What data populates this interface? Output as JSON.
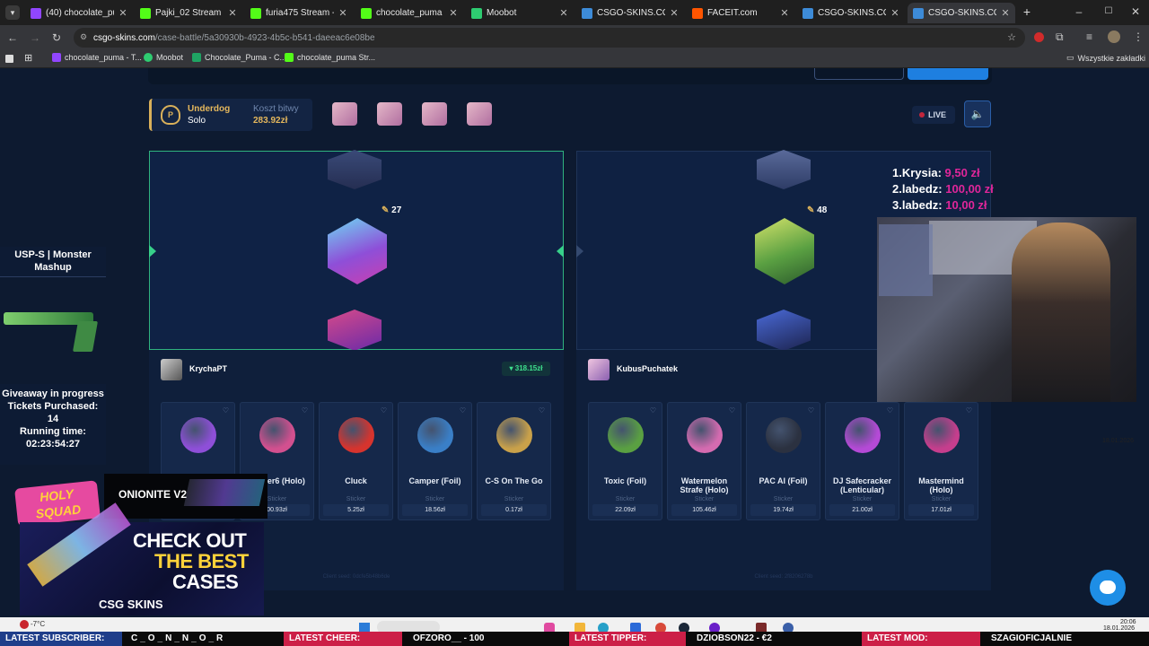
{
  "browser": {
    "tabs": [
      {
        "title": "(40) chocolate_puma",
        "color": "#9146ff"
      },
      {
        "title": "Pajki_02 Stream - Wa",
        "color": "#53fc18"
      },
      {
        "title": "furia475 Stream - Wa",
        "color": "#53fc18"
      },
      {
        "title": "chocolate_puma Strea",
        "color": "#53fc18"
      },
      {
        "title": "Moobot",
        "color": "#2ecc71"
      },
      {
        "title": "CSGO-SKINS.COM -",
        "color": "#3d8bd8"
      },
      {
        "title": "FACEIT.com",
        "color": "#ff5500"
      },
      {
        "title": "CSGO-SKINS.COM -",
        "color": "#3d8bd8"
      },
      {
        "title": "CSGO-SKINS.CO",
        "color": "#3d8bd8"
      }
    ],
    "url_host": "csgo-skins.com",
    "url_path": "/case-battle/5a30930b-4923-4b5c-b541-daeeac6e08be",
    "bookmarks": [
      "chocolate_puma - T...",
      "Moobot",
      "Chocolate_Puma - C...",
      "chocolate_puma Str..."
    ],
    "all_bookmarks": "Wszystkie zakładki"
  },
  "battle": {
    "mode_title": "Underdog",
    "mode_sub": "Solo",
    "cost_label": "Koszt bitwy",
    "cost_value": "283.92zł",
    "live_label": "LIVE",
    "left_count": "27",
    "right_count": "48",
    "left_player": "KrychaPT",
    "left_total": "318.15zł",
    "right_player": "KubusPuchatek",
    "seed_left": "Client seed: 0dcfe5b48b6de",
    "seed_right": "Client seed: 2f8206278b",
    "left_items": [
      {
        "name": "",
        "rarity": "",
        "price": "",
        "color": "#8e4fd8"
      },
      {
        "name": "ge Tier6 (Holo)",
        "rarity": "Sticker",
        "price": "00.93zł",
        "color": "#d2508f"
      },
      {
        "name": "Cluck",
        "rarity": "Sticker",
        "price": "5.25zł",
        "color": "#d6342e"
      },
      {
        "name": "Camper (Foil)",
        "rarity": "Sticker",
        "price": "18.56zł",
        "color": "#3a7fc7"
      },
      {
        "name": "C-S On The Go",
        "rarity": "Sticker",
        "price": "0.17zł",
        "color": "#c9a14a"
      }
    ],
    "right_items": [
      {
        "name": "Toxic (Foil)",
        "rarity": "Sticker",
        "price": "22.09zł",
        "color": "#5aa042"
      },
      {
        "name": "Watermelon Strafe (Holo)",
        "rarity": "Sticker",
        "price": "105.46zł",
        "color": "#d46bb0"
      },
      {
        "name": "PAC AI (Foil)",
        "rarity": "Sticker",
        "price": "19.74zł",
        "color": "#2b3140"
      },
      {
        "name": "DJ Safecracker (Lenticular)",
        "rarity": "Sticker",
        "price": "21.00zł",
        "color": "#b44ad6"
      },
      {
        "name": "Mastermind (Holo)",
        "rarity": "Sticker",
        "price": "17.01zł",
        "color": "#c53e8d"
      }
    ]
  },
  "overlay": {
    "leaderboard": [
      {
        "rank": "1.",
        "name": "Krysia:",
        "amount": "9,50 zł"
      },
      {
        "rank": "2.",
        "name": "labedz:",
        "amount": "100,00 zł"
      },
      {
        "rank": "3.",
        "name": "labedz:",
        "amount": "10,00 zł"
      }
    ],
    "skin_name": "USP-S | Monster Mashup",
    "giveaway_l1": "Giveaway in progress",
    "giveaway_l2": "Tickets Purchased:",
    "giveaway_l3": "14",
    "giveaway_l4": "Running time:",
    "giveaway_l5": "02:23:54:27",
    "onion": "ONIONITE V2",
    "holy": "HOLY SQUAD",
    "promo_1": "CHECK OUT",
    "promo_2": "THE BEST",
    "promo_3": "CASES",
    "brand": "CSG SKINS"
  },
  "ticker": {
    "sub_label": "LATEST SUBSCRIBER:",
    "sub_value": "C_O_N_N_O_R",
    "cheer_label": "LATEST CHEER:",
    "cheer_value": "OFZORO__ - 100",
    "tip_label": "LATEST TIPPER:",
    "tip_value": "DZIOBSON22 - €2",
    "mod_label": "LATEST MOD:",
    "mod_value": "SZAGIOFICJALNIE"
  },
  "taskbar": {
    "weather": "-7°C",
    "time": "20:06",
    "date": "18.01.2026"
  }
}
